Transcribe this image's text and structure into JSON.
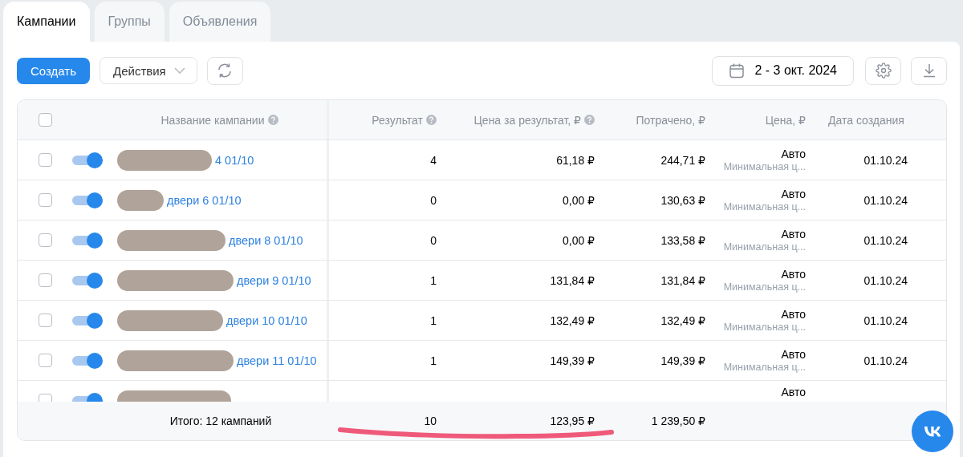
{
  "tabs": [
    {
      "label": "Кампании",
      "selected": true
    },
    {
      "label": "Группы",
      "selected": false
    },
    {
      "label": "Объявления",
      "selected": false
    }
  ],
  "toolbar": {
    "create": "Создать",
    "actions": "Действия",
    "date_range": "2 - 3 окт. 2024"
  },
  "table": {
    "all_checked": false,
    "columns": [
      "Название кампании",
      "Результат",
      "Цена за результат, ₽",
      "Потрачено, ₽",
      "Цена, ₽",
      "Дата создания"
    ],
    "rows": [
      {
        "checked": false,
        "on": true,
        "name": "4 01/10",
        "result": "4",
        "cost_per_result": "61,18 ₽",
        "spent": "244,71 ₽",
        "price": "Авто",
        "price_note": "Минимальная ц...",
        "created": "01.10.24"
      },
      {
        "checked": false,
        "on": true,
        "name": "двери 6 01/10",
        "result": "0",
        "cost_per_result": "0,00 ₽",
        "spent": "130,63 ₽",
        "price": "Авто",
        "price_note": "Минимальная ц...",
        "created": "01.10.24"
      },
      {
        "checked": false,
        "on": true,
        "name": "двери 8 01/10",
        "result": "0",
        "cost_per_result": "0,00 ₽",
        "spent": "133,58 ₽",
        "price": "Авто",
        "price_note": "Минимальная ц...",
        "created": "01.10.24"
      },
      {
        "checked": false,
        "on": true,
        "name": "двери 9 01/10",
        "result": "1",
        "cost_per_result": "131,84 ₽",
        "spent": "131,84 ₽",
        "price": "Авто",
        "price_note": "Минимальная ц...",
        "created": "01.10.24"
      },
      {
        "checked": false,
        "on": true,
        "name": "двери 10 01/10",
        "result": "1",
        "cost_per_result": "132,49 ₽",
        "spent": "132,49 ₽",
        "price": "Авто",
        "price_note": "Минимальная ц...",
        "created": "01.10.24"
      },
      {
        "checked": false,
        "on": true,
        "name": "двери 11 01/10",
        "result": "1",
        "cost_per_result": "149,39 ₽",
        "spent": "149,39 ₽",
        "price": "Авто",
        "price_note": "Минимальная ц...",
        "created": "01.10.24"
      },
      {
        "checked": false,
        "on": true,
        "price": "Авто"
      }
    ],
    "totals": {
      "label": "Итого: 12 кампаний",
      "result": "10",
      "cost_per_result": "123,95 ₽",
      "spent": "1 239,50 ₽"
    }
  }
}
